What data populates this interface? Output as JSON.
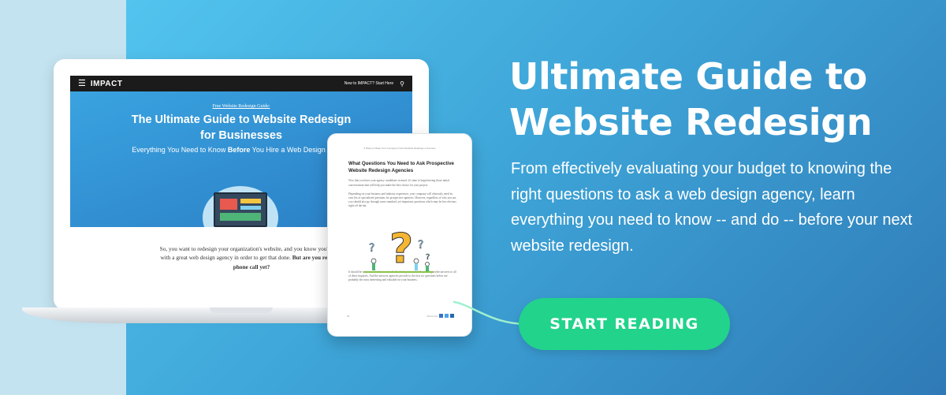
{
  "headline": "Ultimate Guide to Website Redesign",
  "description": "From effectively evaluating your budget to knowing the right questions to ask a web design agency, learn everything you need to know -- and do -- before your next website redesign.",
  "cta_label": "START READING",
  "colors": {
    "accent": "#22d38b",
    "bg_start": "#52c4ee",
    "bg_end": "#2f7ab6",
    "left_band": "#c4e3f0"
  },
  "laptop": {
    "logo": "IMPACT",
    "nav_link": "New to IMPACT? Start Here",
    "kicker": "Free Website Redesign Guide:",
    "hero_title_1": "The Ultimate Guide to Website Redesign",
    "hero_title_2": "for Businesses",
    "hero_sub_pre": "Everything You Need to Know ",
    "hero_sub_bold": "Before",
    "hero_sub_post": " You Hire a Web Design Agency",
    "body_1": "So, you want to redesign your organization's website, and you know you'll need",
    "body_2": "with a great web design agency in order to get that done. ",
    "body_2_bold": "But are you ready to",
    "body_3": "phone call yet?"
  },
  "tablet": {
    "header": "5 Ways to Make Your Company's Next Website Redesign a Success",
    "title": "What Questions You Need to Ask Prospective Website Redesign Agencies",
    "para_1": "Now that you have your agency candidates in mind, it's time to begin having those initial conversations that will help you make the best choice for your project.",
    "para_2": "Depending on your business and industry experience, your company will obviously need its own list of specialized questions for prospective agencies. However, regardless of who you are, you should also go through some standard, yet important, questions which may be less obvious right off the bat.",
    "para_3": "It should be an automatic deterrent in the back of your mind if they can't provide answers to all of these inquiries. And the answers agencies provide to the first six questions below are probably the most interesting and valuable for your business.",
    "page": "26",
    "share": "Share this"
  }
}
